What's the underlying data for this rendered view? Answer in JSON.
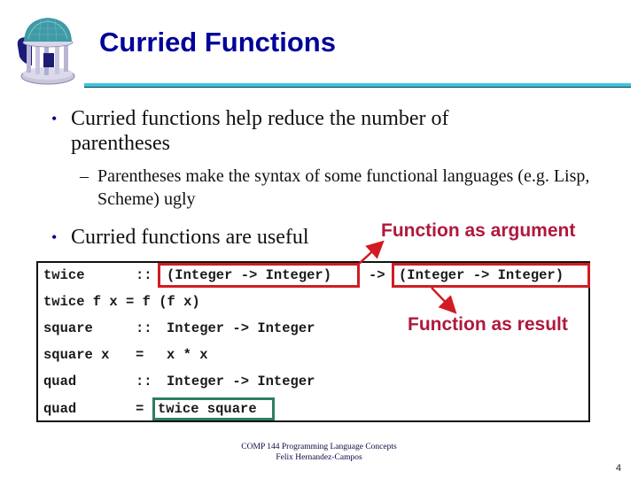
{
  "slide": {
    "title": "Curried Functions",
    "bullets": [
      {
        "text": "Curried functions help reduce the number of parentheses",
        "sub": [
          "Parentheses make the syntax of some functional languages (e.g. Lisp, Scheme) ugly"
        ]
      },
      {
        "text": "Curried functions are useful",
        "sub": []
      }
    ],
    "bullet_glyph": "•",
    "dash_glyph": "–",
    "callouts": {
      "argument": "Function as argument",
      "result": "Function as result"
    },
    "code": {
      "lines": [
        {
          "name": "twice",
          "sep": "::",
          "parts": [
            "(Integer -> Integer)",
            "->",
            "(Integer -> Integer)"
          ]
        },
        {
          "full": "twice f x = f (f x)"
        },
        {
          "name": "square",
          "sep": "::",
          "rest": "Integer -> Integer"
        },
        {
          "name": "square x",
          "sep": "=",
          "rest": "x * x"
        },
        {
          "name": "quad",
          "sep": "::",
          "rest": "Integer -> Integer"
        },
        {
          "name": "quad",
          "sep": "=",
          "rest": "twice square"
        }
      ]
    },
    "footer": {
      "line1": "COMP 144 Programming Language Concepts",
      "line2": "Felix Hernandez-Campos"
    },
    "page_number": "4",
    "colors": {
      "title": "#00009a",
      "callout": "#b0183c",
      "highlight_red": "#d01c22",
      "highlight_green": "#2e7d66",
      "rule": "#3ec3e0"
    },
    "logo_icon": "old-well-rotunda-logo"
  }
}
